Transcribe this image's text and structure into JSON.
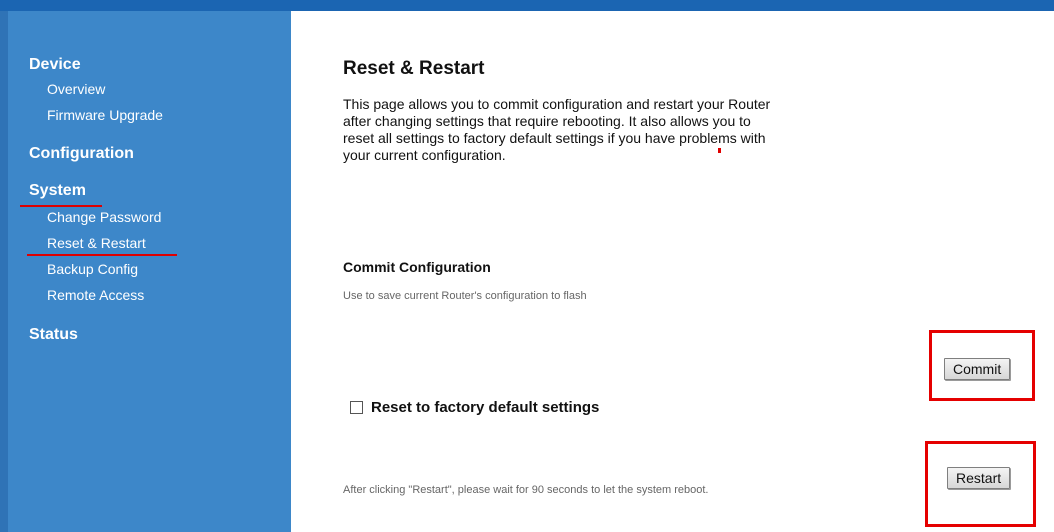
{
  "sidebar": {
    "sections": [
      {
        "label": "Device",
        "items": [
          "Overview",
          "Firmware Upgrade"
        ]
      },
      {
        "label": "Configuration",
        "items": []
      },
      {
        "label": "System",
        "items": [
          "Change Password",
          "Reset & Restart",
          "Backup Config",
          "Remote Access"
        ]
      },
      {
        "label": "Status",
        "items": []
      }
    ],
    "active_section": "System",
    "active_item": "Reset & Restart"
  },
  "page": {
    "title": "Reset & Restart",
    "description": "This page allows you to commit configuration and restart your Router after changing settings that require rebooting. It also allows you to reset all settings to factory default settings if you have problems with your current configuration."
  },
  "commit": {
    "title": "Commit Configuration",
    "help": "Use to save current Router's configuration to flash",
    "button_label": "Commit"
  },
  "reset": {
    "checkbox_label": "Reset to factory default settings",
    "checked": false
  },
  "restart": {
    "note": "After clicking \"Restart\", please wait for 90 seconds to let the system reboot.",
    "button_label": "Restart"
  },
  "colors": {
    "sidebar": "#3d87c9",
    "topbar": "#1b65b2",
    "highlight": "#e50000"
  }
}
